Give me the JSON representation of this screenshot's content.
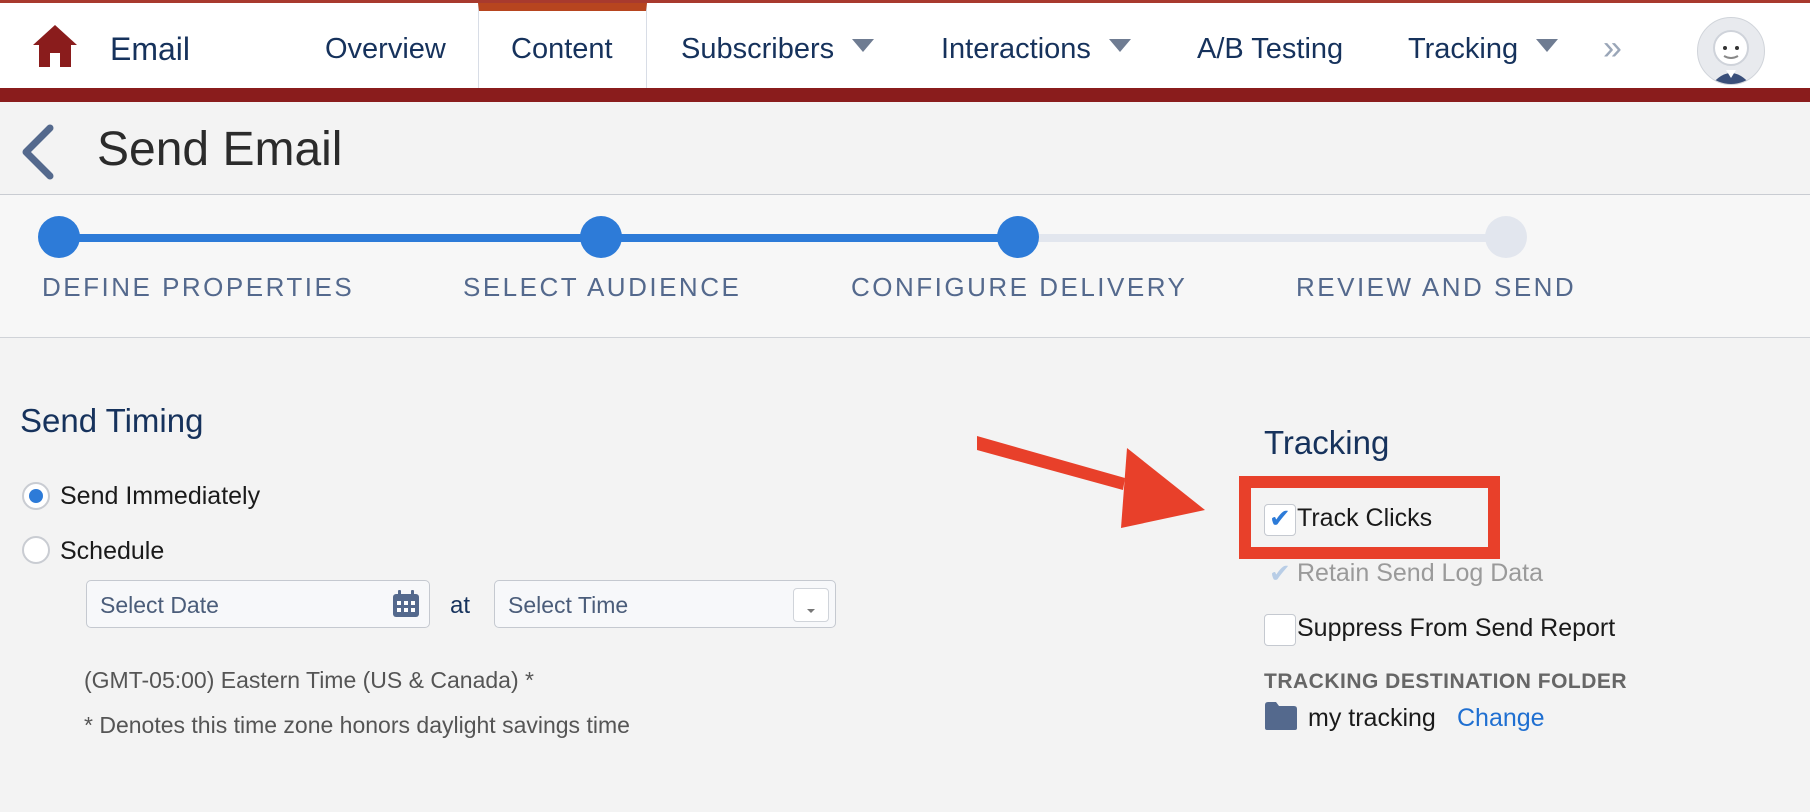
{
  "nav": {
    "app_name": "Email",
    "items": [
      {
        "label": "Overview",
        "has_caret": false
      },
      {
        "label": "Content",
        "has_caret": false,
        "active": true
      },
      {
        "label": "Subscribers",
        "has_caret": true
      },
      {
        "label": "Interactions",
        "has_caret": true
      },
      {
        "label": "A/B Testing",
        "has_caret": false
      },
      {
        "label": "Tracking",
        "has_caret": true
      }
    ],
    "overflow_glyph": "»",
    "icons": {
      "home": "home-icon",
      "overflow": "double-chevron-right-icon",
      "avatar": "einstein-avatar-icon"
    },
    "colors": {
      "brand_bar": "#8a1c1c",
      "active_tab_accent": "#b7451f"
    }
  },
  "header": {
    "title": "Send Email",
    "back_icon": "chevron-left-icon"
  },
  "stepper": {
    "steps": [
      {
        "label": "DEFINE PROPERTIES",
        "complete": true
      },
      {
        "label": "SELECT AUDIENCE",
        "complete": true
      },
      {
        "label": "CONFIGURE DELIVERY",
        "complete": true,
        "current": true
      },
      {
        "label": "REVIEW AND SEND",
        "complete": false
      }
    ],
    "colors": {
      "complete": "#2d7bd8",
      "incomplete": "#e2e6ee"
    }
  },
  "send_timing": {
    "title": "Send Timing",
    "options": [
      {
        "label": "Send Immediately",
        "selected": true
      },
      {
        "label": "Schedule",
        "selected": false
      }
    ],
    "date_placeholder": "Select Date",
    "at_label": "at",
    "time_placeholder": "Select Time",
    "timezone": "(GMT-05:00) Eastern Time (US & Canada) *",
    "dst_note": "* Denotes this time zone honors daylight savings time"
  },
  "tracking": {
    "title": "Tracking",
    "options": [
      {
        "label": "Track Clicks",
        "checked": true,
        "disabled": false
      },
      {
        "label": "Retain Send Log Data",
        "checked": true,
        "disabled": true
      },
      {
        "label": "Suppress From Send Report",
        "checked": false,
        "disabled": false
      }
    ],
    "folder_heading": "TRACKING DESTINATION FOLDER",
    "folder_name": "my tracking",
    "change_label": "Change"
  },
  "annotation": {
    "color": "#e8402a"
  }
}
